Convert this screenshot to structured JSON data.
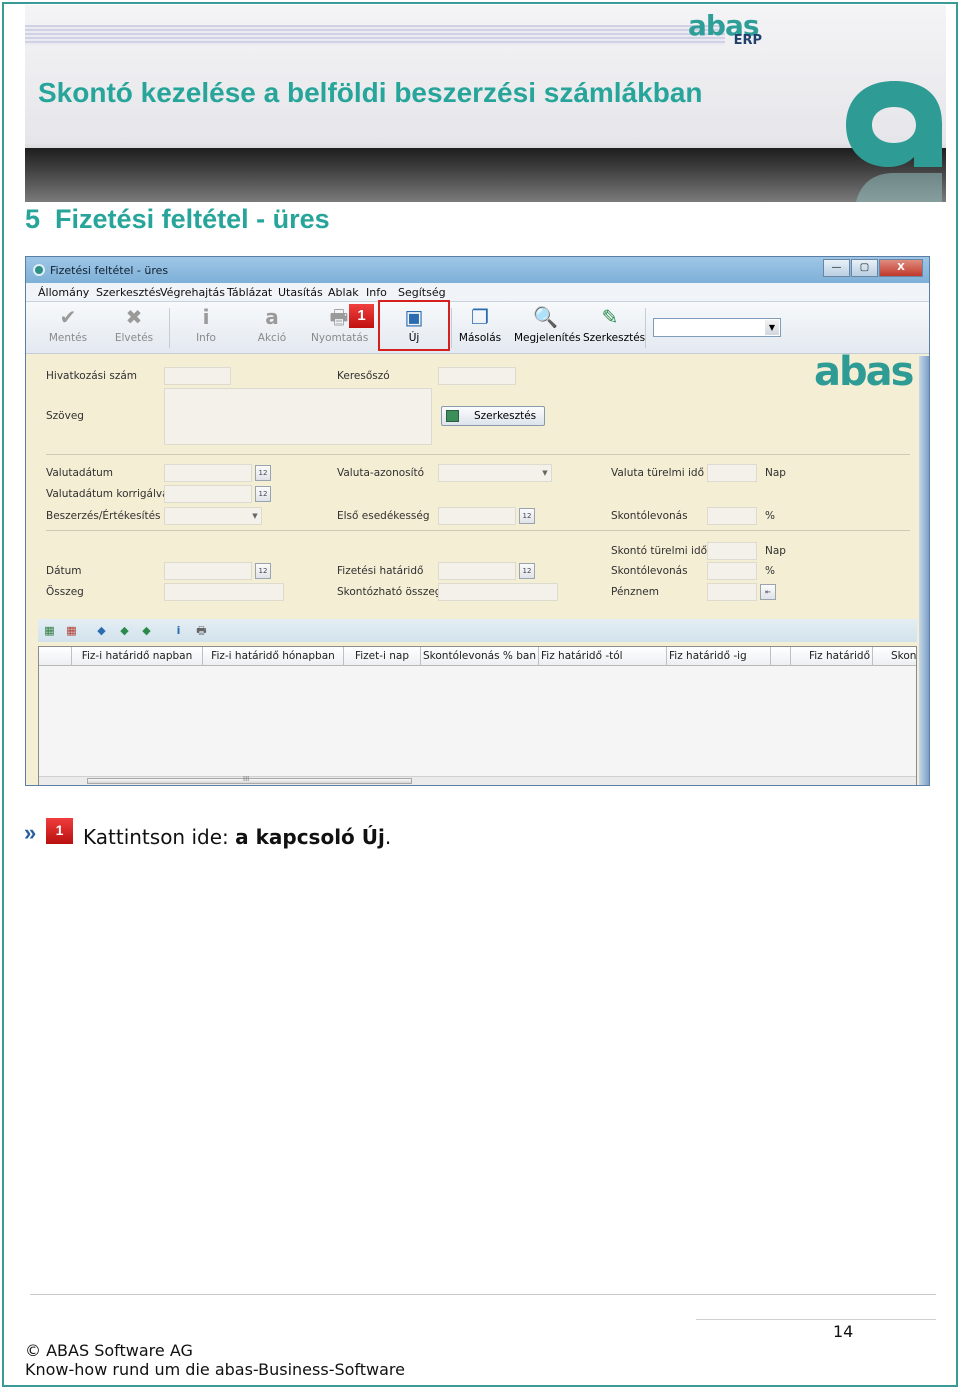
{
  "header": {
    "title": "Skontó kezelése a belföldi beszerzési számlákban",
    "logo_word": "abas",
    "logo_sub": "ERP"
  },
  "section": {
    "number": "5",
    "title": "Fizetési feltétel - üres"
  },
  "window": {
    "title": "Fizetési feltétel - üres",
    "buttons": [
      "—",
      "▢",
      "X"
    ],
    "menu": [
      "Állomány",
      "Szerkesztés",
      "Végrehajtás",
      "Táblázat",
      "Utasítás",
      "Ablak",
      "Info",
      "Segítség"
    ],
    "toolbar": {
      "mentes": "Mentés",
      "elvetes": "Elvetés",
      "info": "Info",
      "akcio": "Akció",
      "nyomtatas": "Nyomtatás",
      "uj": "Új",
      "masolas": "Másolás",
      "megjelenites": "Megjelenítés",
      "szerkesztes": "Szerkesztés",
      "marker": "1",
      "logo": "abas"
    },
    "form": {
      "hivatkozasi_szam": "Hivatkozási szám",
      "kereszo": "Keresőszó",
      "szoveg": "Szöveg",
      "szerkesztes_button": "Szerkesztés",
      "valutadatum": "Valutadátum",
      "valutadatum_korrigalva": "Valutadátum korrigálva",
      "beszerzes_ertekesites": "Beszerzés/Értékesítés",
      "valuta_azonosito": "Valuta-azonosító",
      "elso_esedekesseg": "Első esedékesség",
      "valuta_turelmi_ido": "Valuta türelmi idő",
      "nap1": "Nap",
      "skontolevonas1": "Skontólevonás",
      "pct1": "%",
      "skonto_turelmi_ido": "Skontó türelmi idő",
      "nap2": "Nap",
      "skontolevonas2": "Skontólevonás",
      "pct2": "%",
      "penznem": "Pénznem",
      "datum": "Dátum",
      "osszeg": "Összeg",
      "fizetesi_hatarido": "Fizetési határidő",
      "skontozhato_osszeg": "Skontózható összeg"
    },
    "table": {
      "columns": [
        "Fiz-i határidő napban",
        "Fiz-i határidő hónapban",
        "Fizet-i nap",
        "Skontólevonás % ban",
        "Fiz határidő -tól",
        "Fiz határidő -ig",
        "Fiz határidő",
        "Skon"
      ],
      "scroll_thumb": "III"
    }
  },
  "instruction": {
    "bullet": "»",
    "badge": "1",
    "prefix": "Kattintson ide: ",
    "bold": "a kapcsoló Új",
    "suffix": "."
  },
  "footer": {
    "page_number": "14",
    "copyright": "© ABAS Software AG",
    "tagline": "Know-how rund um die abas-Business-Software"
  },
  "colors": {
    "accent": "#27a59a",
    "highlight_red": "#d62020",
    "form_bg": "#f4eed5"
  }
}
